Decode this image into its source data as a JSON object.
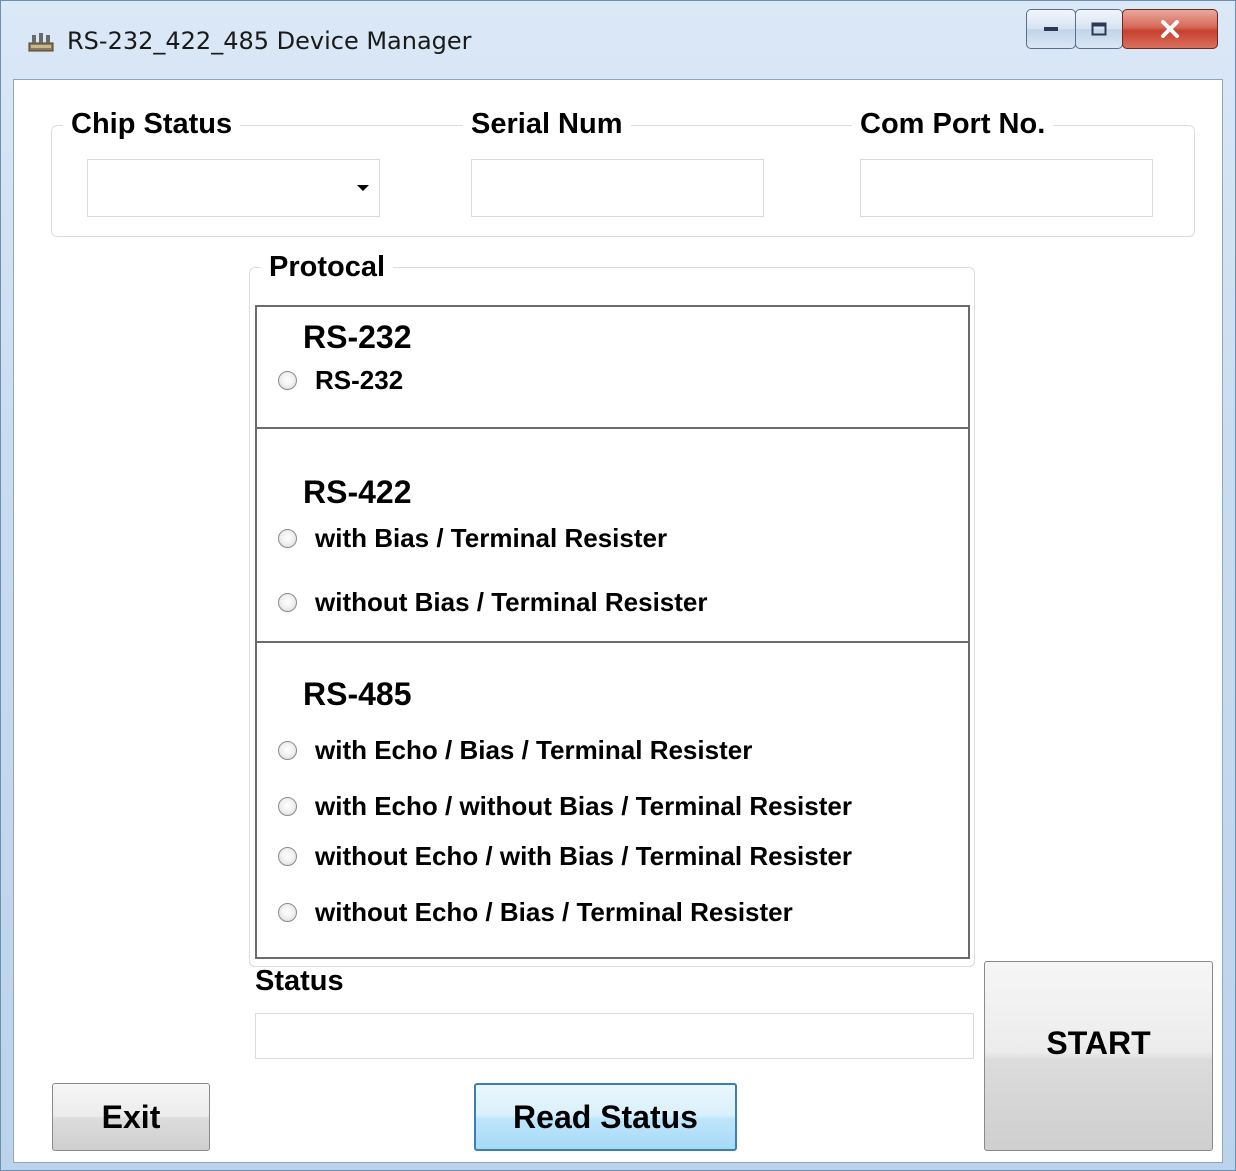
{
  "window": {
    "title": "RS-232_422_485 Device Manager"
  },
  "top_group": {
    "chip_status_label": "Chip Status",
    "chip_status_value": "",
    "serial_num_label": "Serial Num",
    "serial_num_value": "",
    "com_port_label": "Com Port No.",
    "com_port_value": ""
  },
  "protocol": {
    "legend": "Protocal",
    "rs232": {
      "title": "RS-232",
      "options": [
        "RS-232"
      ]
    },
    "rs422": {
      "title": "RS-422",
      "options": [
        "with Bias / Terminal Resister",
        "without Bias / Terminal Resister"
      ]
    },
    "rs485": {
      "title": "RS-485",
      "options": [
        "with Echo / Bias / Terminal Resister",
        "with Echo / without Bias / Terminal Resister",
        "without Echo / with Bias / Terminal Resister",
        "without Echo / Bias / Terminal Resister"
      ]
    }
  },
  "status": {
    "label": "Status",
    "value": ""
  },
  "buttons": {
    "start": "START",
    "exit": "Exit",
    "read_status": "Read Status"
  }
}
